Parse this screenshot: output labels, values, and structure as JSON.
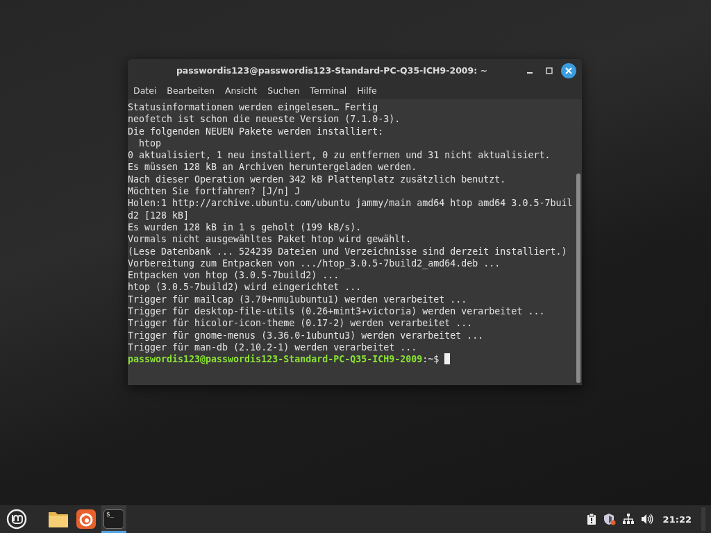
{
  "window": {
    "title": "passwordis123@passwordis123-Standard-PC-Q35-ICH9-2009: ~"
  },
  "menu": [
    "Datei",
    "Bearbeiten",
    "Ansicht",
    "Suchen",
    "Terminal",
    "Hilfe"
  ],
  "lines": [
    "Statusinformationen werden eingelesen… Fertig",
    "neofetch ist schon die neueste Version (7.1.0-3).",
    "Die folgenden NEUEN Pakete werden installiert:",
    "  htop",
    "0 aktualisiert, 1 neu installiert, 0 zu entfernen und 31 nicht aktualisiert.",
    "Es müssen 128 kB an Archiven heruntergeladen werden.",
    "Nach dieser Operation werden 342 kB Plattenplatz zusätzlich benutzt.",
    "Möchten Sie fortfahren? [J/n] J",
    "Holen:1 http://archive.ubuntu.com/ubuntu jammy/main amd64 htop amd64 3.0.5-7buil",
    "d2 [128 kB]",
    "Es wurden 128 kB in 1 s geholt (199 kB/s).",
    "Vormals nicht ausgewähltes Paket htop wird gewählt.",
    "(Lese Datenbank ... 524239 Dateien und Verzeichnisse sind derzeit installiert.)",
    "Vorbereitung zum Entpacken von .../htop_3.0.5-7build2_amd64.deb ...",
    "Entpacken von htop (3.0.5-7build2) ...",
    "htop (3.0.5-7build2) wird eingerichtet ...",
    "Trigger für mailcap (3.70+nmu1ubuntu1) werden verarbeitet ...",
    "Trigger für desktop-file-utils (0.26+mint3+victoria) werden verarbeitet ...",
    "Trigger für hicolor-icon-theme (0.17-2) werden verarbeitet ...",
    "Trigger für gnome-menus (3.36.0-1ubuntu3) werden verarbeitet ...",
    "Trigger für man-db (2.10.2-1) werden verarbeitet ..."
  ],
  "prompt": {
    "user_host": "passwordis123@passwordis123-Standard-PC-Q35-ICH9-2009",
    "suffix": ":~$"
  },
  "taskbar": {
    "launchers": [
      {
        "kind": "menu",
        "selected": false
      },
      {
        "kind": "folder",
        "selected": false
      },
      {
        "kind": "browser",
        "selected": false
      },
      {
        "kind": "terminal",
        "label": "$_",
        "selected": true
      }
    ],
    "tray": [
      {
        "kind": "clipboard"
      },
      {
        "kind": "shield"
      },
      {
        "kind": "network"
      },
      {
        "kind": "volume"
      }
    ],
    "clock": "21:22"
  }
}
